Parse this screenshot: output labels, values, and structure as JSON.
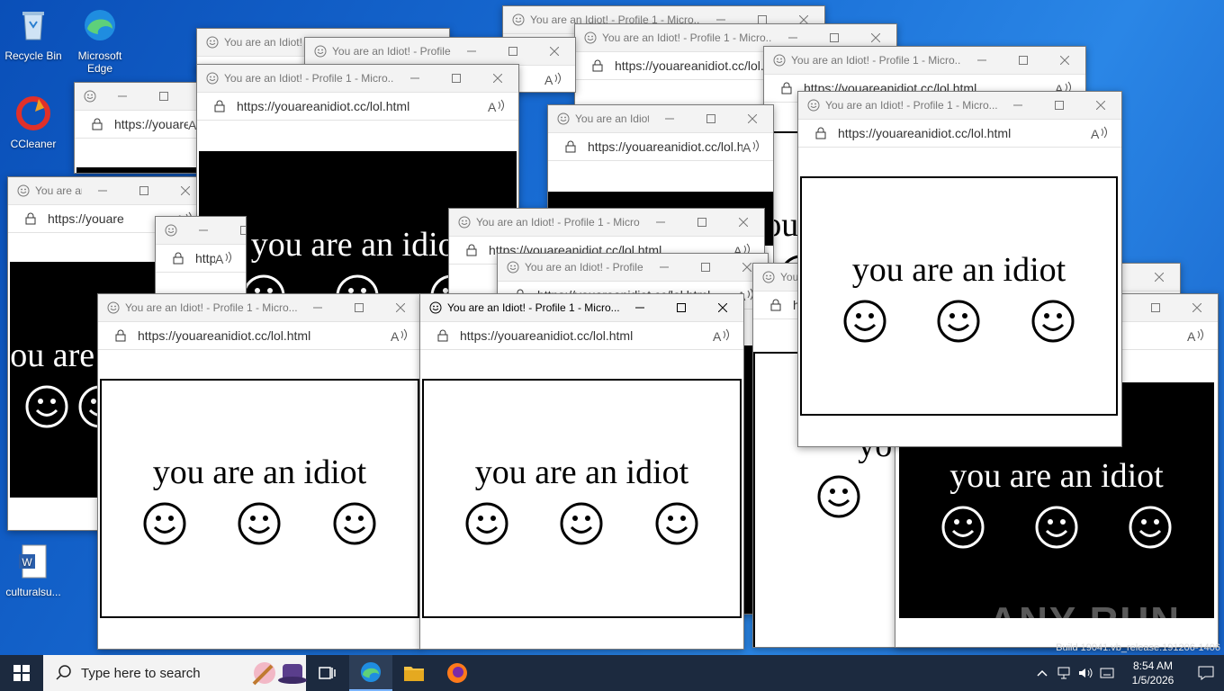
{
  "desktop": {
    "icons": [
      {
        "label": "Recycle Bin",
        "icon": "recycle-bin-icon"
      },
      {
        "label": "Microsoft Edge",
        "icon": "edge-icon"
      },
      {
        "label": "CCleaner",
        "icon": "ccleaner-icon"
      },
      {
        "label": "culturalsu...",
        "icon": "word-document-icon"
      }
    ]
  },
  "window": {
    "title_short": "You are an Idiot! - Profile 1 - Micro...",
    "title_tiny": "You are an Idiot! - Pr",
    "url": "https://youareanidiot.cc/lol.html",
    "url_short": "https://youare",
    "phrase": "you are an idiot",
    "faces_count": 3
  },
  "taskbar": {
    "search_placeholder": "Type here to search",
    "apps": [
      "task-view-icon",
      "edge-icon",
      "file-explorer-icon",
      "firefox-icon"
    ],
    "time": "8:54 AM",
    "date": "1/5/2026"
  },
  "watermark": "ANY RUN",
  "build_text": "Build 19041.vb_release.191206-1406",
  "colors": {
    "desktop": "#1a6fd6",
    "taskbar": "#1c2a3f",
    "accent": "#7ab4ff"
  }
}
